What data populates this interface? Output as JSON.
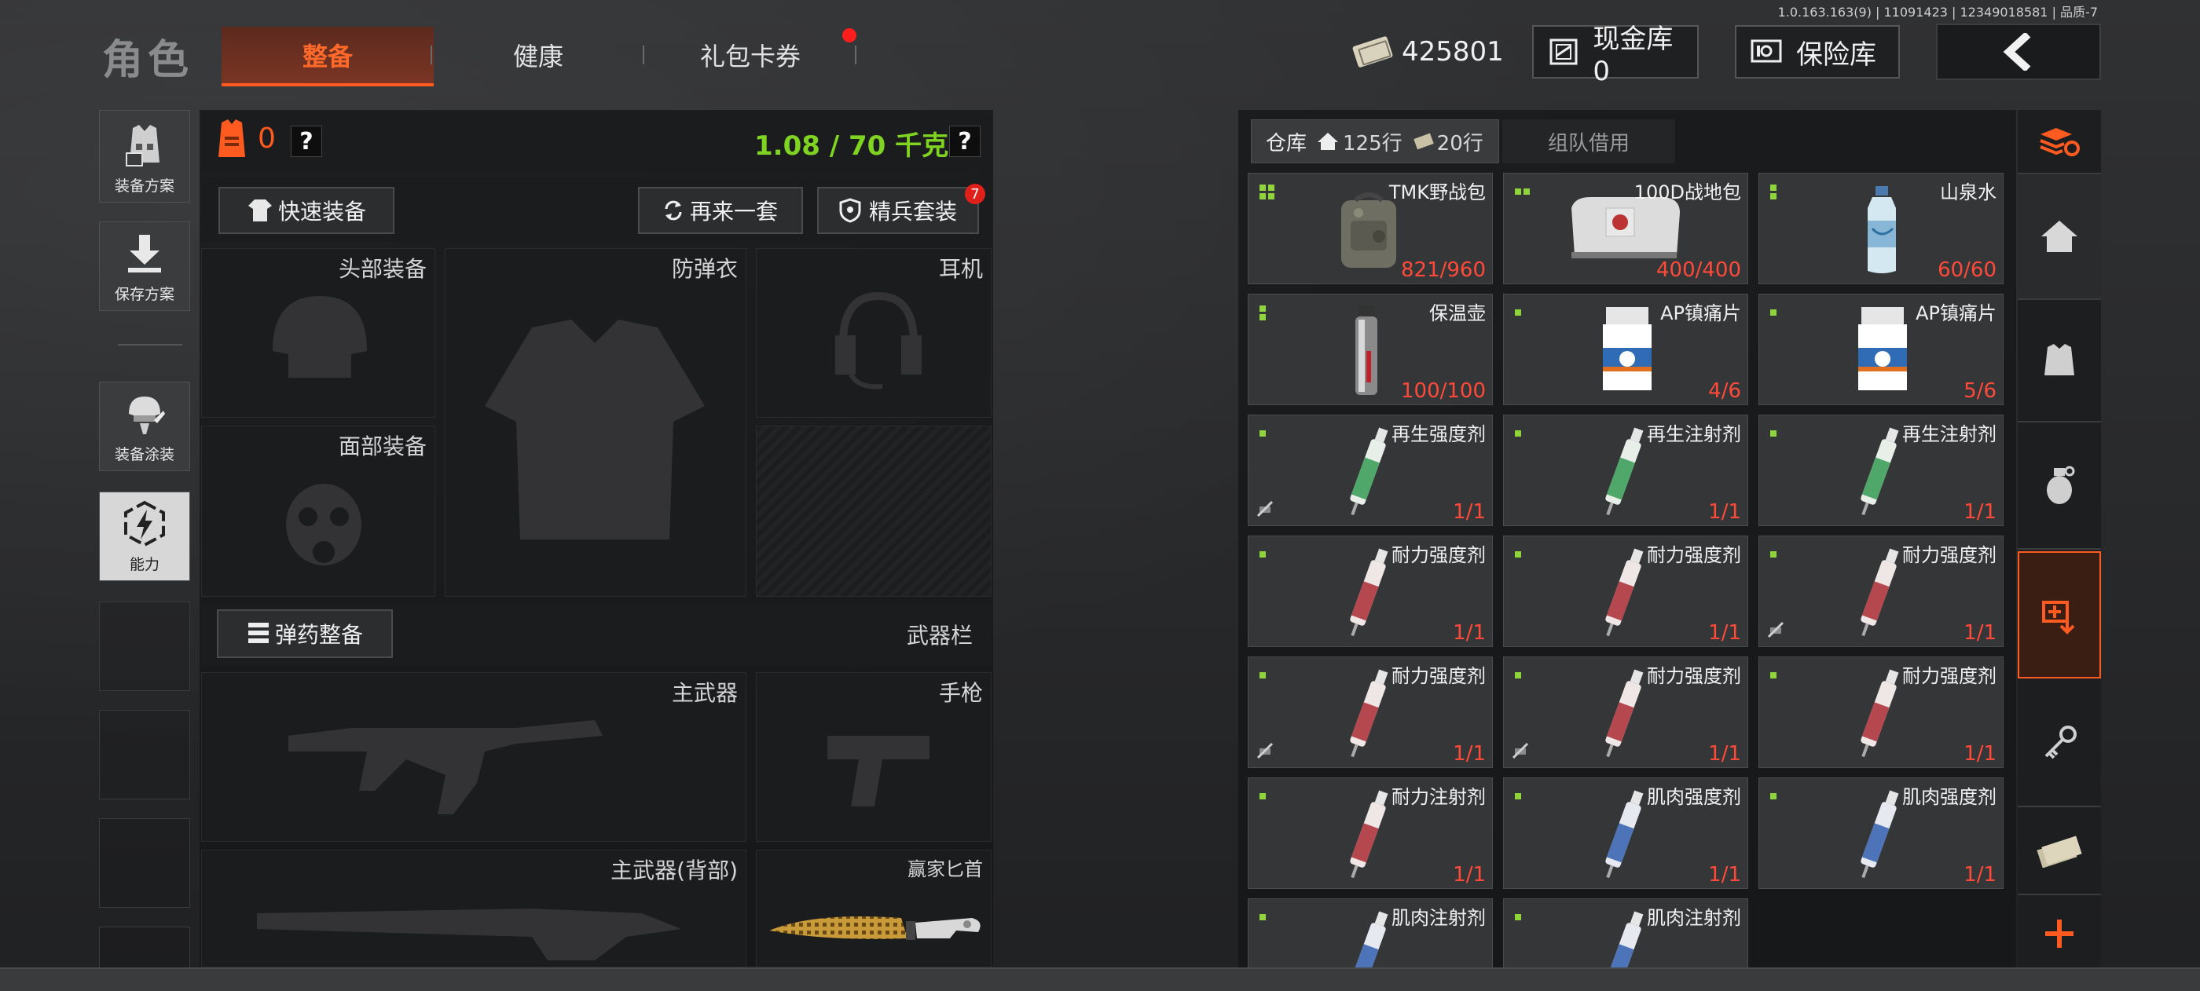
{
  "version": "1.0.163.163(9) | 11091423 | 12349018581 | 品质-7",
  "header": {
    "category": "角色",
    "tabs": [
      "整备",
      "健康",
      "礼包卡券"
    ],
    "money": "425801",
    "cash_vault": "现金库 0",
    "safe_box": "保险库"
  },
  "sidebar": {
    "loadout_plan": "装备方案",
    "save_plan": "保存方案",
    "skin": "装备涂装",
    "ability": "能力"
  },
  "equipment": {
    "armor_count": "0",
    "weight": "1.08 / 70 千克",
    "quick_equip": "快速装备",
    "repeat_set": "再来一套",
    "elite_set": "精兵套装",
    "elite_badge": "7",
    "slots": {
      "head": "头部装备",
      "vest": "防弹衣",
      "earphone": "耳机",
      "face": "面部装备",
      "ammo": "弹药整备",
      "weapon_bar": "武器栏",
      "primary": "主武器",
      "pistol": "手枪",
      "primary_back": "主武器(背部)",
      "knife": "赢家匕首"
    }
  },
  "storage": {
    "tab_warehouse": "仓库",
    "rows_home": "125行",
    "rows_ticket": "20行",
    "tab_team": "组队借用",
    "items": [
      {
        "name": "TMK野战包",
        "qty": "821/960",
        "art": "backpack",
        "mark": "dots4",
        "ban": false
      },
      {
        "name": "100D战地包",
        "qty": "400/400",
        "art": "bag",
        "mark": "dots2",
        "ban": false
      },
      {
        "name": "山泉水",
        "qty": "60/60",
        "art": "bottle",
        "mark": "dots2v",
        "ban": false
      },
      {
        "name": "保温壶",
        "qty": "100/100",
        "art": "flask",
        "mark": "dots2v",
        "ban": false
      },
      {
        "name": "AP镇痛片",
        "qty": "4/6",
        "art": "pills",
        "mark": "dot",
        "ban": false
      },
      {
        "name": "AP镇痛片",
        "qty": "5/6",
        "art": "pills",
        "mark": "dot",
        "ban": false
      },
      {
        "name": "再生强度剂",
        "qty": "1/1",
        "art": "inj-green",
        "mark": "dot",
        "ban": true
      },
      {
        "name": "再生注射剂",
        "qty": "1/1",
        "art": "inj-green",
        "mark": "dot",
        "ban": false
      },
      {
        "name": "再生注射剂",
        "qty": "1/1",
        "art": "inj-green",
        "mark": "dot",
        "ban": false
      },
      {
        "name": "耐力强度剂",
        "qty": "1/1",
        "art": "inj-red",
        "mark": "dot",
        "ban": false
      },
      {
        "name": "耐力强度剂",
        "qty": "1/1",
        "art": "inj-red",
        "mark": "dot",
        "ban": false
      },
      {
        "name": "耐力强度剂",
        "qty": "1/1",
        "art": "inj-red",
        "mark": "dot",
        "ban": true
      },
      {
        "name": "耐力强度剂",
        "qty": "1/1",
        "art": "inj-red",
        "mark": "dot",
        "ban": true
      },
      {
        "name": "耐力强度剂",
        "qty": "1/1",
        "art": "inj-red",
        "mark": "dot",
        "ban": true
      },
      {
        "name": "耐力强度剂",
        "qty": "1/1",
        "art": "inj-red",
        "mark": "dot",
        "ban": false
      },
      {
        "name": "耐力注射剂",
        "qty": "1/1",
        "art": "inj-red",
        "mark": "dot",
        "ban": false
      },
      {
        "name": "肌肉强度剂",
        "qty": "1/1",
        "art": "inj-blue",
        "mark": "dot",
        "ban": false
      },
      {
        "name": "肌肉强度剂",
        "qty": "1/1",
        "art": "inj-blue",
        "mark": "dot",
        "ban": false
      },
      {
        "name": "肌肉注射剂",
        "qty": "",
        "art": "inj-blue",
        "mark": "dot",
        "ban": false
      },
      {
        "name": "肌肉注射剂",
        "qty": "",
        "art": "inj-blue",
        "mark": "dot",
        "ban": false
      }
    ]
  },
  "colors": {
    "accent": "#ff5a1f",
    "weight_green": "#7fd321",
    "qty_red": "#ff4a3a",
    "mark_green": "#8fd43a"
  }
}
